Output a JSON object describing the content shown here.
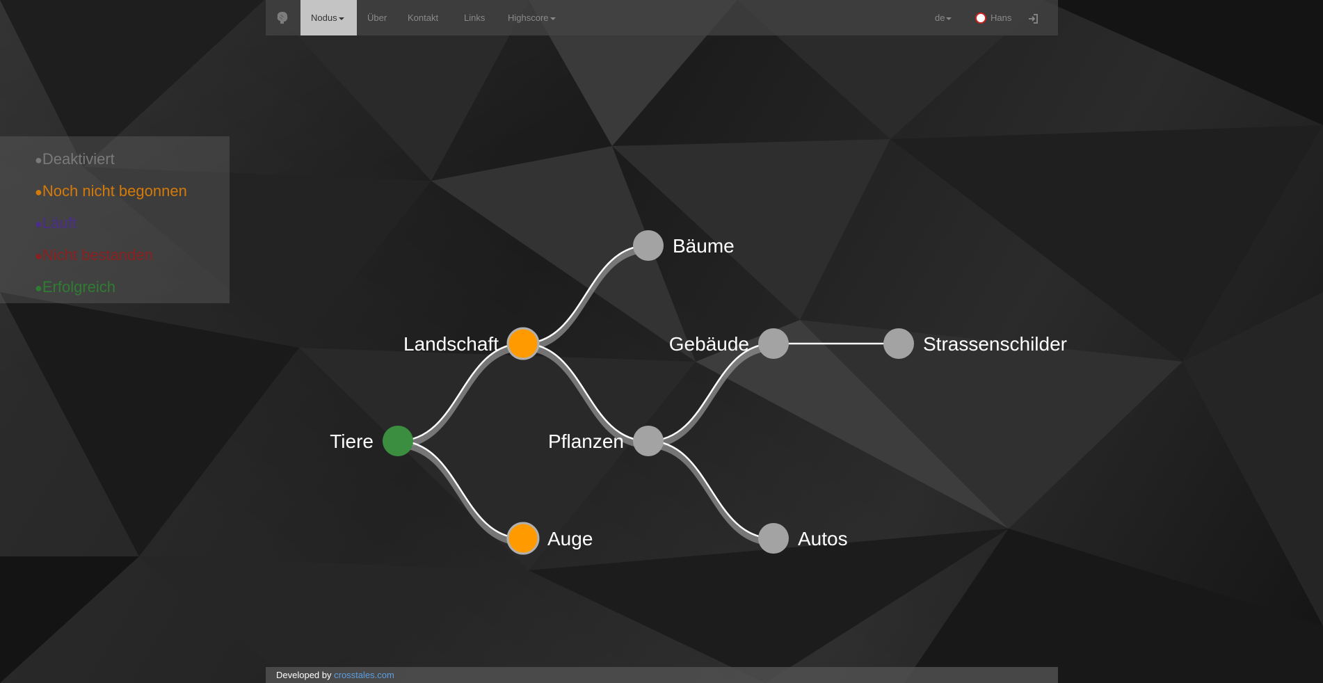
{
  "nav": {
    "logo_icon": "brain-icon",
    "items": [
      {
        "label": "Nodus",
        "active": true,
        "dropdown": true
      },
      {
        "label": "Über",
        "active": false,
        "dropdown": false
      },
      {
        "label": "Kontakt",
        "active": false,
        "dropdown": false
      },
      {
        "label": "Links",
        "active": false,
        "dropdown": false
      },
      {
        "label": "Highscore",
        "active": false,
        "dropdown": true
      }
    ],
    "language": "de",
    "user": "Hans",
    "logout_icon": "sign-in-icon"
  },
  "legend": {
    "items": [
      {
        "label": "Deaktiviert",
        "color": "#7a7a7a"
      },
      {
        "label": "Noch nicht begonnen",
        "color": "#d47a0a"
      },
      {
        "label": "Läuft",
        "color": "#4b2d8a"
      },
      {
        "label": "Nicht bestanden",
        "color": "#8a2020"
      },
      {
        "label": "Erfolgreich",
        "color": "#2e7d32"
      }
    ]
  },
  "graph": {
    "nodes": [
      {
        "id": "tiere",
        "label": "Tiere",
        "status": "Erfolgreich",
        "color": "#3b8e3f"
      },
      {
        "id": "landschaft",
        "label": "Landschaft",
        "status": "Noch nicht begonnen",
        "color": "#ff9a00"
      },
      {
        "id": "auge",
        "label": "Auge",
        "status": "Noch nicht begonnen",
        "color": "#ff9a00"
      },
      {
        "id": "baeume",
        "label": "Bäume",
        "status": "Deaktiviert",
        "color": "#a3a3a3"
      },
      {
        "id": "pflanzen",
        "label": "Pflanzen",
        "status": "Deaktiviert",
        "color": "#a3a3a3"
      },
      {
        "id": "gebaeude",
        "label": "Gebäude",
        "status": "Deaktiviert",
        "color": "#a3a3a3"
      },
      {
        "id": "autos",
        "label": "Autos",
        "status": "Deaktiviert",
        "color": "#a3a3a3"
      },
      {
        "id": "strassenschilder",
        "label": "Strassenschilder",
        "status": "Deaktiviert",
        "color": "#a3a3a3"
      }
    ],
    "edges": [
      [
        "tiere",
        "landschaft"
      ],
      [
        "tiere",
        "auge"
      ],
      [
        "landschaft",
        "baeume"
      ],
      [
        "landschaft",
        "pflanzen"
      ],
      [
        "pflanzen",
        "gebaeude"
      ],
      [
        "pflanzen",
        "autos"
      ],
      [
        "gebaeude",
        "strassenschilder"
      ]
    ]
  },
  "footer": {
    "prefix": "Developed by",
    "link": "crosstales.com"
  }
}
